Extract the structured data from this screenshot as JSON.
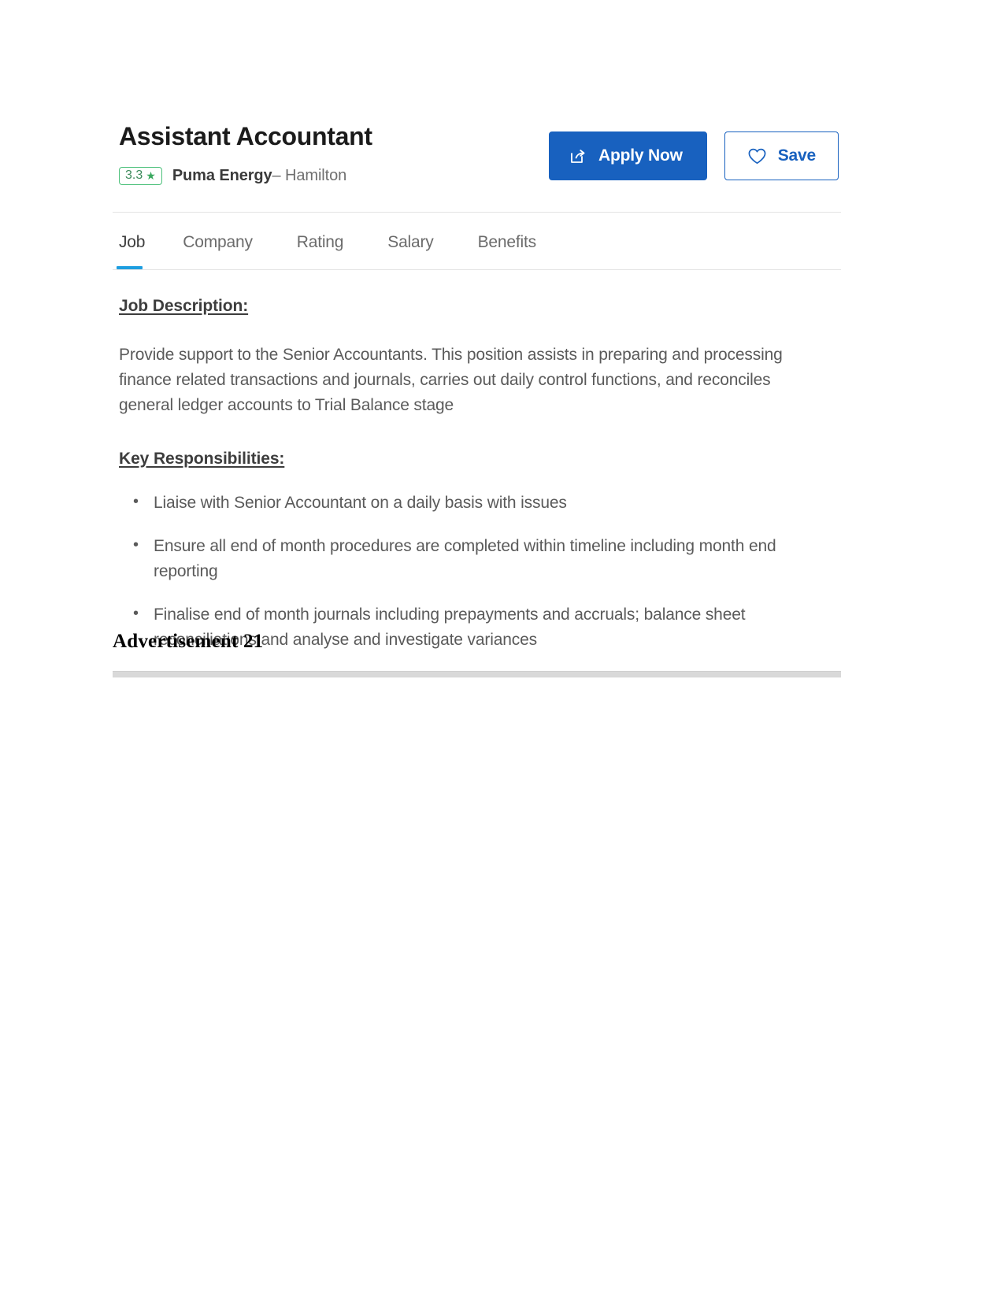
{
  "job": {
    "title": "Assistant Accountant",
    "rating": "3.3",
    "rating_star_icon": "star-icon",
    "employer": "Puma Energy",
    "location": "– Hamilton"
  },
  "actions": {
    "apply_label": "Apply Now",
    "apply_icon": "share-arrow-icon",
    "save_label": "Save",
    "save_icon": "heart-icon"
  },
  "tabs": [
    {
      "label": "Job",
      "active": true
    },
    {
      "label": "Company",
      "active": false
    },
    {
      "label": "Rating",
      "active": false
    },
    {
      "label": "Salary",
      "active": false
    },
    {
      "label": "Benefits",
      "active": false
    }
  ],
  "sections": {
    "description_heading": "Job Description:",
    "description_body": "Provide support to the Senior Accountants. This position assists in preparing and processing finance related transactions and journals, carries out daily control functions, and reconciles general ledger accounts to Trial Balance stage",
    "responsibilities_heading": "Key Responsibilities:",
    "responsibilities": [
      "Liaise with Senior Accountant on a daily basis with issues",
      "Ensure all end of month procedures are completed within timeline including month end reporting",
      "Finalise end of month journals including prepayments and accruals; balance sheet reconciliations and analyse and investigate variances"
    ]
  },
  "caption": "Advertisement 21",
  "colors": {
    "primary_blue": "#1861bf",
    "tab_active_underline": "#1d9ee0",
    "rating_green": "#4bc07a"
  }
}
